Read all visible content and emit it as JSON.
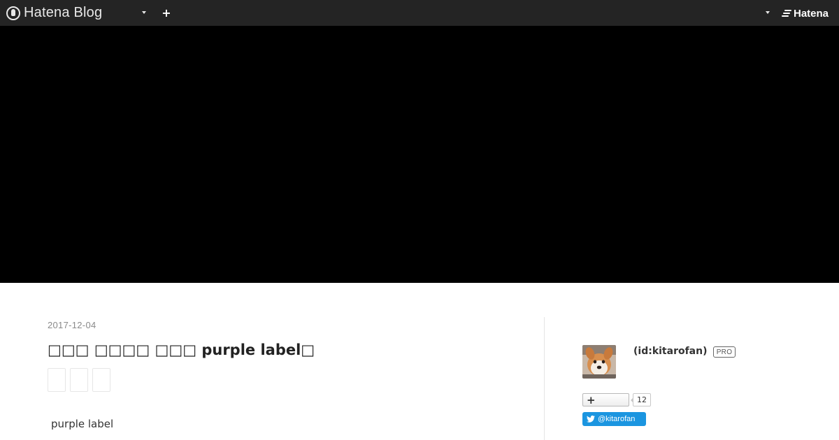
{
  "header": {
    "brand": "Hatena Blog",
    "new_post_icon": "plus-icon",
    "account_logo": "Hatena"
  },
  "entry": {
    "date": "2017-12-04",
    "title": "□□□ □□□□ □□□ purple label□",
    "body_text": "purple label"
  },
  "profile": {
    "id": "(id:kitarofan)",
    "badge": "PRO",
    "subscriber_count": "12",
    "twitter_handle": "@kitarofan"
  },
  "colors": {
    "header_bg": "#242424",
    "hero_bg": "#000000",
    "twitter_blue": "#1b95e0"
  }
}
